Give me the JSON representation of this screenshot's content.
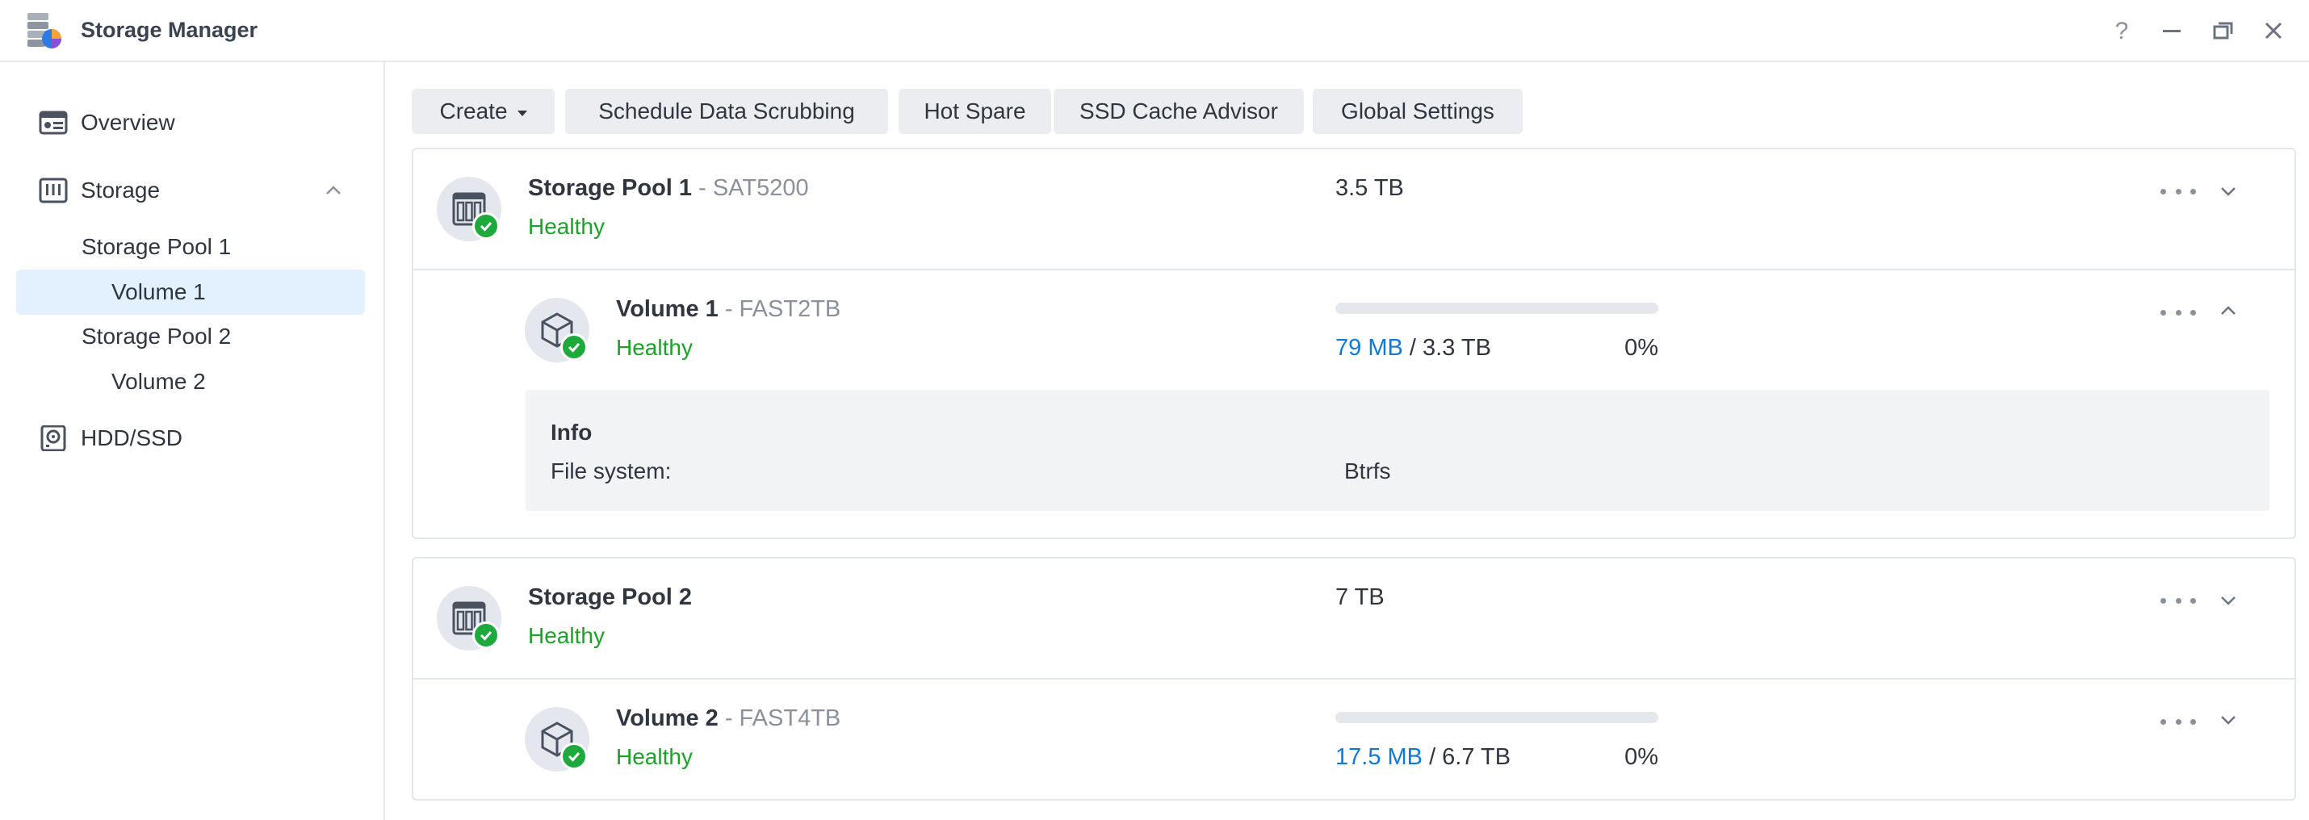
{
  "window": {
    "title": "Storage Manager",
    "controls": [
      "help-icon",
      "minimize-icon",
      "restore-icon",
      "close-icon"
    ]
  },
  "sidebar": {
    "overview": "Overview",
    "storage": "Storage",
    "pools": [
      {
        "label": "Storage Pool 1",
        "volumes": [
          "Volume 1"
        ]
      },
      {
        "label": "Storage Pool 2",
        "volumes": [
          "Volume 2"
        ]
      }
    ],
    "hdd": "HDD/SSD",
    "selected": "Volume 1"
  },
  "toolbar": {
    "create": "Create",
    "scrub": "Schedule Data Scrubbing",
    "hot_spare": "Hot Spare",
    "ssd_cache": "SSD Cache Advisor",
    "global": "Global Settings"
  },
  "pools": [
    {
      "name": "Storage Pool 1",
      "model": "- SAT5200",
      "status": "Healthy",
      "size": "3.5 TB",
      "volume": {
        "name": "Volume 1",
        "model": "- FAST2TB",
        "status": "Healthy",
        "used": "79 MB",
        "total": "/ 3.3 TB",
        "percent": "0%",
        "usage_fraction": 0,
        "expanded": true,
        "info": {
          "title": "Info",
          "fs_label": "File system:",
          "fs_value": "Btrfs"
        }
      }
    },
    {
      "name": "Storage Pool 2",
      "model": "",
      "status": "Healthy",
      "size": "7 TB",
      "volume": {
        "name": "Volume 2",
        "model": "- FAST4TB",
        "status": "Healthy",
        "used": "17.5 MB",
        "total": "/ 6.7 TB",
        "percent": "0%",
        "usage_fraction": 0,
        "expanded": false
      }
    }
  ],
  "colors": {
    "healthy": "#1ca12a",
    "accent": "#0f7ad6",
    "selected_bg": "#e3f0fd"
  }
}
